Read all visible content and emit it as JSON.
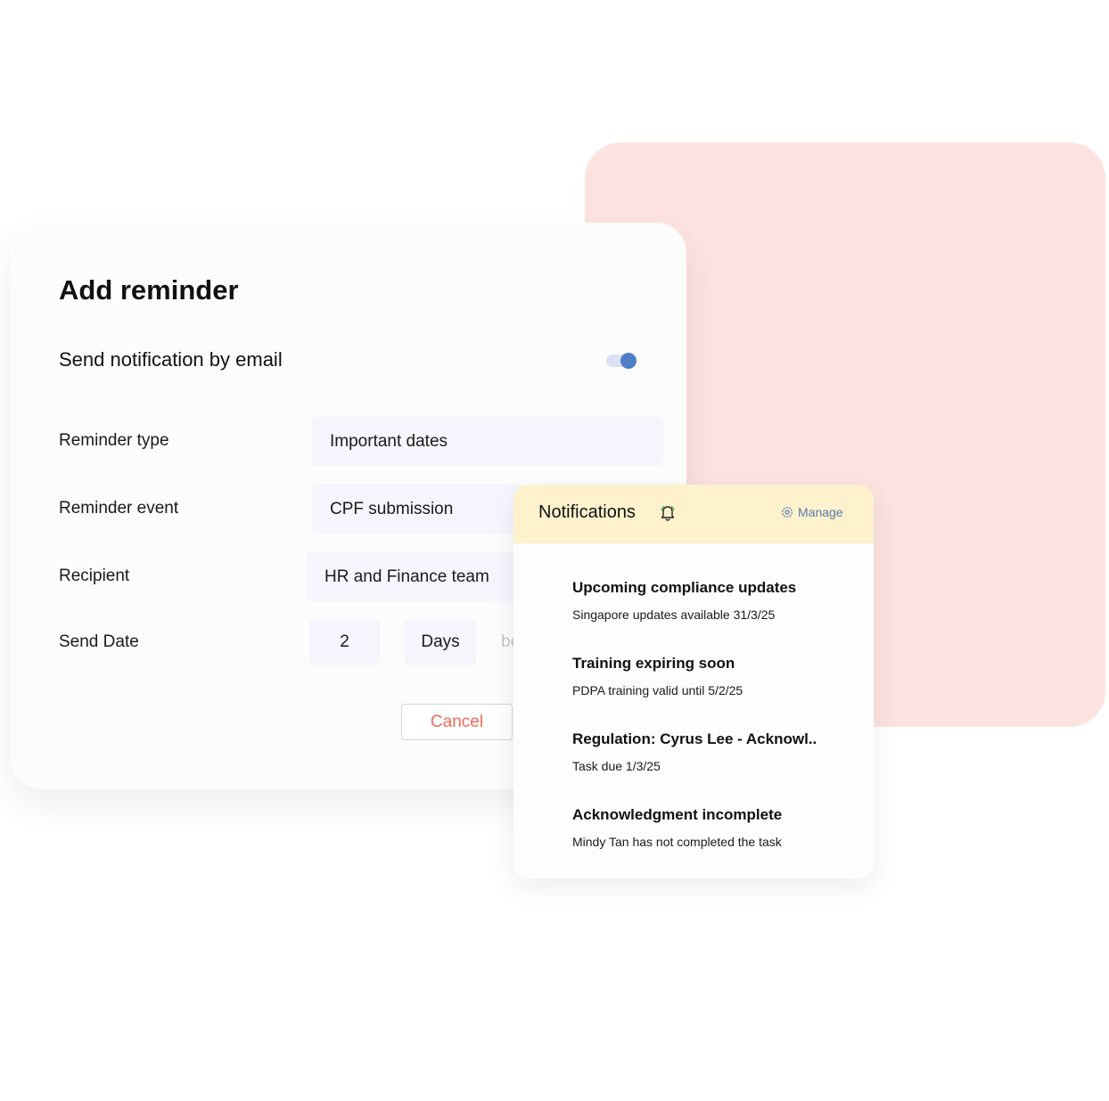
{
  "reminder": {
    "title": "Add reminder",
    "email_label": "Send notification by email",
    "email_enabled": true,
    "rows": [
      {
        "label": "Reminder type",
        "value": "Important dates"
      },
      {
        "label": "Reminder event",
        "value": "CPF submission"
      },
      {
        "label": "Recipient",
        "value": "HR and Finance team"
      },
      {
        "label": "Send Date",
        "amount": "2",
        "unit": "Days",
        "suffix_partial": "be"
      }
    ],
    "cancel_label": "Cancel"
  },
  "notifications": {
    "title": "Notifications",
    "manage_label": "Manage",
    "items": [
      {
        "title": "Upcoming compliance updates",
        "subtitle": "Singapore updates available 31/3/25"
      },
      {
        "title": "Training expiring soon",
        "subtitle": "PDPA training valid until 5/2/25"
      },
      {
        "title": "Regulation: Cyrus Lee - Acknowl..",
        "subtitle": "Task due 1/3/25"
      },
      {
        "title": "Acknowledgment incomplete",
        "subtitle": "Mindy Tan has not completed the task"
      }
    ]
  },
  "colors": {
    "accent_blue": "#4f7fc9",
    "cancel_red": "#f06a55",
    "background_card": "#fde3df",
    "notification_header": "#fdf2cc"
  },
  "icons": [
    "toggle-switch",
    "bell-icon",
    "gear-icon"
  ]
}
